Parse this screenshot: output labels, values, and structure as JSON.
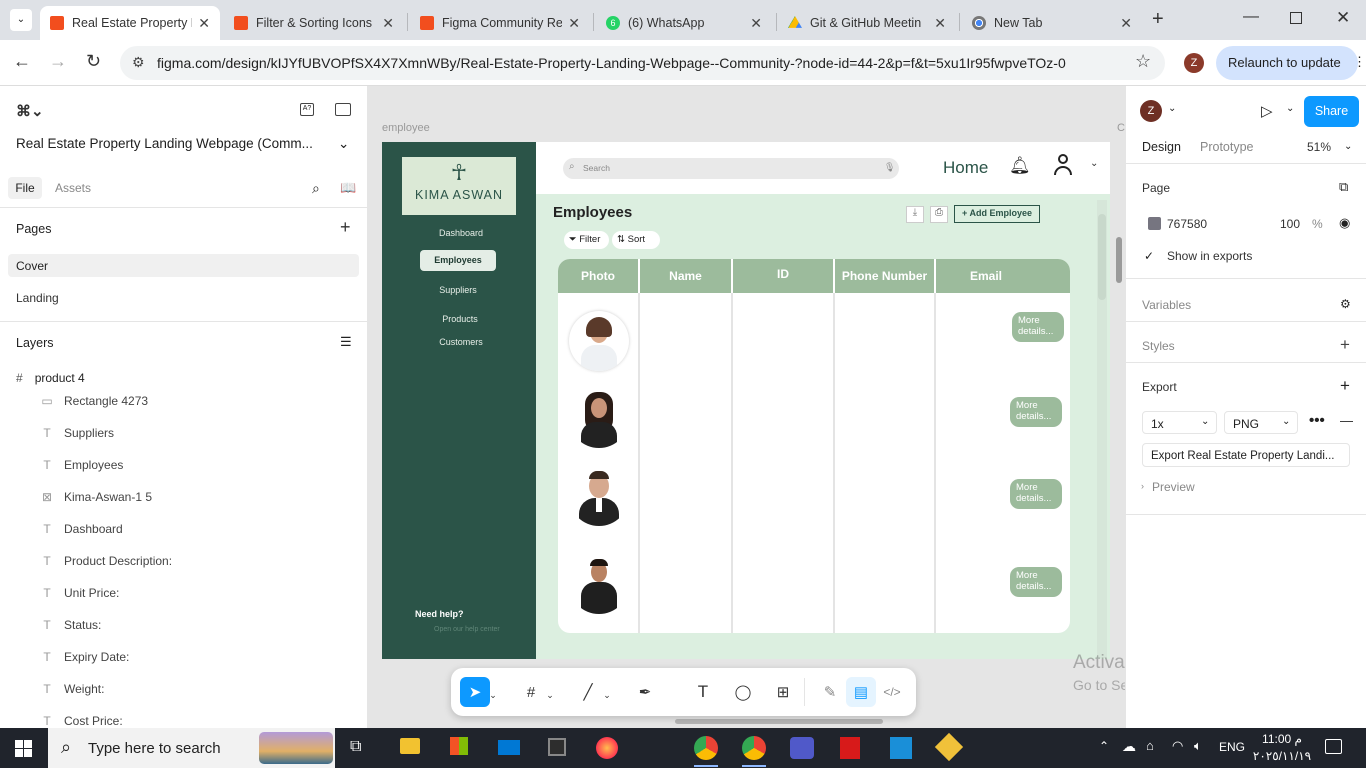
{
  "browser": {
    "tabs": [
      {
        "title": "Real Estate Property L",
        "favicon_color": "#f24e1e",
        "active": true
      },
      {
        "title": "Filter & Sorting Icons",
        "favicon_color": "#f24e1e"
      },
      {
        "title": "Figma Community Re",
        "favicon_color": "#f24e1e"
      },
      {
        "title": "(6) WhatsApp",
        "favicon_color": "#25d366",
        "badge": "6"
      },
      {
        "title": "Git & GitHub Meetin",
        "favicon_color": "#0f9d58"
      },
      {
        "title": "New Tab",
        "favicon_color": "#777777"
      }
    ],
    "url": "figma.com/design/kIJYfUBVOPfSX4X7XmnWBy/Real-Estate-Property-Landing-Webpage--Community-?node-id=44-2&p=f&t=5xu1Ir95fwpveTOz-0",
    "profile_initial": "Z",
    "relaunch_label": "Relaunch to update"
  },
  "left_panel": {
    "file_title": "Real Estate Property Landing Webpage (Comm...",
    "tab_file": "File",
    "tab_assets": "Assets",
    "pages_heading": "Pages",
    "pages": [
      "Cover",
      "Landing"
    ],
    "layers_heading": "Layers",
    "root_layer": "product 4",
    "layers": [
      {
        "name": "Rectangle 4273",
        "icon": "rect-icon"
      },
      {
        "name": "Suppliers",
        "icon": "text-icon"
      },
      {
        "name": "Employees",
        "icon": "text-icon"
      },
      {
        "name": "Kima-Aswan-1 5",
        "icon": "image-icon"
      },
      {
        "name": "Dashboard",
        "icon": "text-icon"
      },
      {
        "name": "Product Description:",
        "icon": "text-icon"
      },
      {
        "name": "Unit Price:",
        "icon": "text-icon"
      },
      {
        "name": "Status:",
        "icon": "text-icon"
      },
      {
        "name": "Expiry Date:",
        "icon": "text-icon"
      },
      {
        "name": "Weight:",
        "icon": "text-icon"
      },
      {
        "name": "Cost Price:",
        "icon": "text-icon"
      }
    ]
  },
  "canvas": {
    "frame_label": "employee",
    "frame_label_right": "C",
    "design": {
      "logo_text": "KIMA ASWAN",
      "nav": [
        "Dashboard",
        "Employees",
        "Suppliers",
        "Products",
        "Customers"
      ],
      "active_nav": "Employees",
      "help_title": "Need help?",
      "help_link": "Open our help center",
      "search_placeholder": "Search",
      "home_label": "Home",
      "page_title": "Employees",
      "add_button": "+ Add  Employee",
      "filter_label": "Filter",
      "sort_label": "Sort",
      "columns": [
        "Photo",
        "Name",
        "ID",
        "Phone Number",
        "Email"
      ],
      "more_label_1": "More",
      "more_label_2": "details...",
      "rows": 4
    },
    "watermark_title": "Activate Windows",
    "watermark_sub": "Go to Settings to activate Windows."
  },
  "right_panel": {
    "profile_initial": "Z",
    "share_label": "Share",
    "tab_design": "Design",
    "tab_prototype": "Prototype",
    "zoom": "51%",
    "page_heading": "Page",
    "page_color_hex": "767580",
    "page_opacity": "100",
    "percent": "%",
    "show_in_exports": "Show in exports",
    "variables": "Variables",
    "styles": "Styles",
    "export_heading": "Export",
    "export_scale": "1x",
    "export_format": "PNG",
    "export_button": "Export Real Estate Property Landi...",
    "preview": "Preview"
  },
  "taskbar": {
    "search_placeholder": "Type here to search",
    "language": "ENG",
    "time": "11:00 م",
    "date": "٢٠٢٥/١١/١٩"
  },
  "colors": {
    "figma_blue": "#0d99ff",
    "sidebar_green": "#2b5448",
    "table_header": "#9cbb9c",
    "content_bg": "#dcefe0"
  }
}
